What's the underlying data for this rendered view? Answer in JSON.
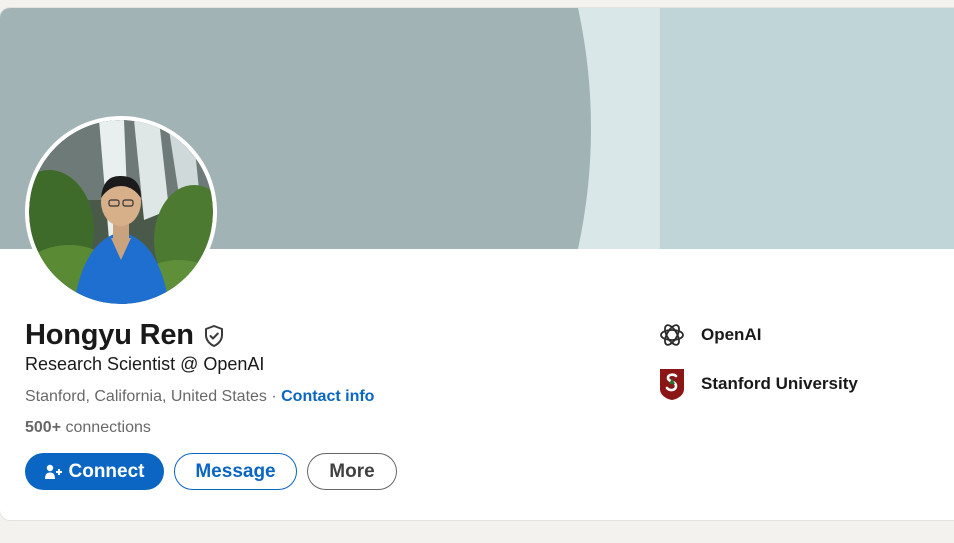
{
  "profile": {
    "name": "Hongyu Ren",
    "headline": "Research Scientist @ OpenAI",
    "location": "Stanford, California, United States",
    "separator": " · ",
    "contact_info_label": "Contact info",
    "connections_count": "500+",
    "connections_label": " connections",
    "verified_icon": "verified-shield-icon"
  },
  "actions": {
    "connect_label": "Connect",
    "message_label": "Message",
    "more_label": "More"
  },
  "experience_summary": [
    {
      "label": "OpenAI",
      "icon": "openai-logo-icon"
    },
    {
      "label": "Stanford University",
      "icon": "stanford-logo-icon"
    }
  ],
  "colors": {
    "brand_blue": "#0a66c2",
    "banner_left": "#a2b3b6",
    "banner_right": "#c0d5d8"
  }
}
